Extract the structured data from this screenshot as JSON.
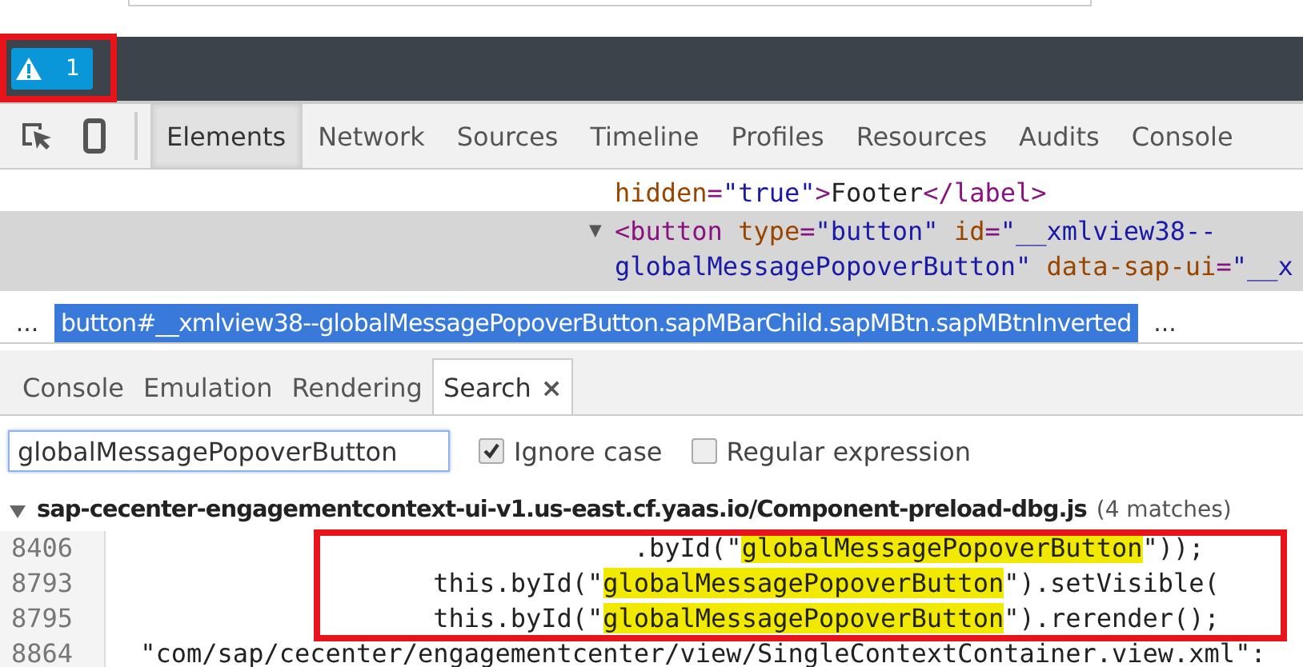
{
  "app_bar": {
    "warning_count": "1"
  },
  "toolbar": {
    "tabs": [
      {
        "label": "Elements",
        "selected": true
      },
      {
        "label": "Network",
        "selected": false
      },
      {
        "label": "Sources",
        "selected": false
      },
      {
        "label": "Timeline",
        "selected": false
      },
      {
        "label": "Profiles",
        "selected": false
      },
      {
        "label": "Resources",
        "selected": false
      },
      {
        "label": "Audits",
        "selected": false
      },
      {
        "label": "Console",
        "selected": false
      }
    ]
  },
  "elements_panel": {
    "nodes": [
      {
        "selected": false,
        "lines": [
          [
            {
              "kind": "attr",
              "text": "hidden"
            },
            {
              "kind": "tag",
              "text": "="
            },
            {
              "kind": "value",
              "text": "\"true\""
            },
            {
              "kind": "tag",
              "text": ">"
            },
            {
              "kind": "text",
              "text": "Footer"
            },
            {
              "kind": "tag",
              "text": "</label>"
            }
          ]
        ]
      },
      {
        "selected": true,
        "toggle": "▼",
        "lines": [
          [
            {
              "kind": "tag",
              "text": "<button"
            },
            {
              "kind": "attr",
              "text": " type"
            },
            {
              "kind": "tag",
              "text": "="
            },
            {
              "kind": "value",
              "text": "\"button\""
            },
            {
              "kind": "attr",
              "text": " id"
            },
            {
              "kind": "tag",
              "text": "="
            },
            {
              "kind": "value",
              "text": "\"__xmlview38--"
            }
          ],
          [
            {
              "kind": "value",
              "text": "globalMessagePopoverButton\""
            },
            {
              "kind": "attr",
              "text": " data-sap-ui"
            },
            {
              "kind": "tag",
              "text": "="
            },
            {
              "kind": "value",
              "text": "\"__x"
            }
          ]
        ]
      }
    ]
  },
  "breadcrumb": {
    "leading": "...",
    "current": "button#__xmlview38--globalMessagePopoverButton.sapMBarChild.sapMBtn.sapMBtnInverted",
    "trailing": "..."
  },
  "drawer_tabs": [
    {
      "label": "Console",
      "selected": false
    },
    {
      "label": "Emulation",
      "selected": false
    },
    {
      "label": "Rendering",
      "selected": false
    },
    {
      "label": "Search",
      "selected": true,
      "close": "×"
    }
  ],
  "search": {
    "value": "globalMessagePopoverButton",
    "options": [
      {
        "label": "Ignore case",
        "checked": true
      },
      {
        "label": "Regular expression",
        "checked": false
      }
    ]
  },
  "results": {
    "expanded": true,
    "file": "sap-cecenter-engagementcontext-ui-v1.us-east.cf.yaas.io/Component-preload-dbg.js",
    "count": "(4 matches)",
    "lines": [
      {
        "number": "8406",
        "segments": [
          {
            "text": "                                 .byId(\"",
            "highlighted": false
          },
          {
            "text": "globalMessagePopoverButton",
            "highlighted": true
          },
          {
            "text": "\"));",
            "highlighted": false
          }
        ]
      },
      {
        "number": "8793",
        "segments": [
          {
            "text": "                    this.byId(\"",
            "highlighted": false
          },
          {
            "text": "globalMessagePopoverButton",
            "highlighted": true
          },
          {
            "text": "\").setVisible(",
            "highlighted": false
          }
        ]
      },
      {
        "number": "8795",
        "segments": [
          {
            "text": "                    this.byId(\"",
            "highlighted": false
          },
          {
            "text": "globalMessagePopoverButton",
            "highlighted": true
          },
          {
            "text": "\").rerender();",
            "highlighted": false
          }
        ]
      },
      {
        "number": "8864",
        "segments": [
          {
            "text": " \"com/sap/cecenter/engagementcenter/view/SingleContextContainer.view.xml\":",
            "highlighted": false
          }
        ]
      }
    ]
  }
}
